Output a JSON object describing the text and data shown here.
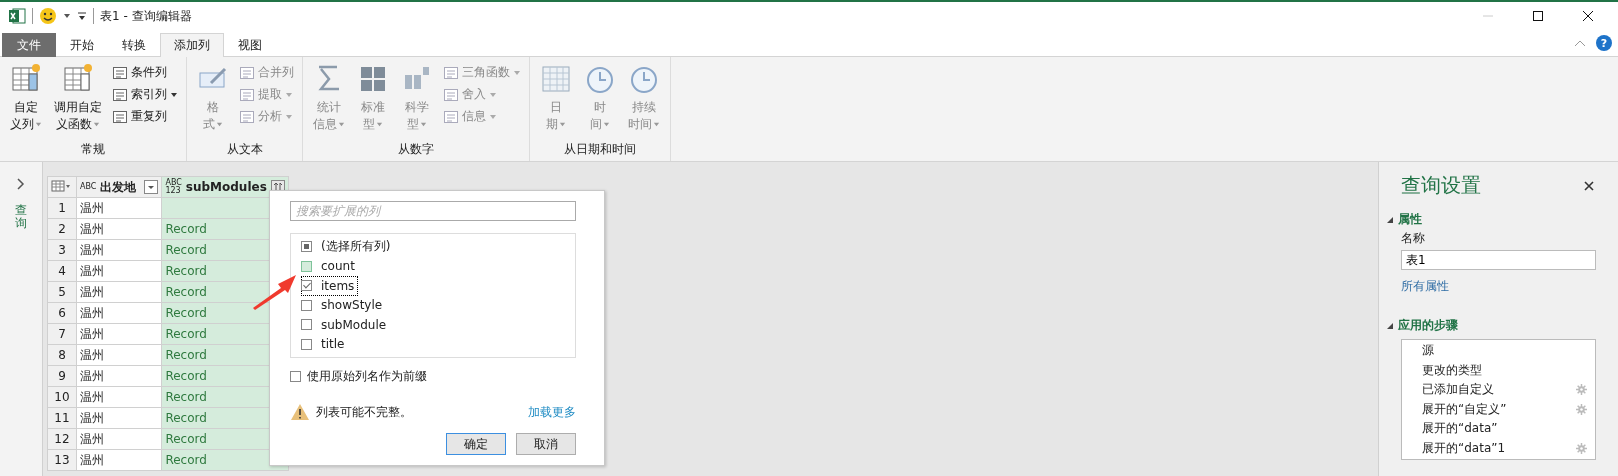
{
  "window": {
    "title": "表1 - 查询编辑器",
    "help": "?"
  },
  "tabs": [
    {
      "label": "文件",
      "kind": "file",
      "selected": false
    },
    {
      "label": "开始",
      "kind": "tab",
      "selected": false
    },
    {
      "label": "转换",
      "kind": "tab",
      "selected": false
    },
    {
      "label": "添加列",
      "kind": "tab",
      "selected": true
    },
    {
      "label": "视图",
      "kind": "tab",
      "selected": false
    }
  ],
  "ribbon_groups": [
    {
      "label": "常规",
      "large": [
        {
          "lines": [
            "自定",
            "义列"
          ],
          "disabled": false
        },
        {
          "lines": [
            "调用自定",
            "义函数"
          ],
          "disabled": false
        }
      ],
      "small": [
        {
          "label": "条件列",
          "disabled": false,
          "dropdown": false
        },
        {
          "label": "索引列",
          "disabled": false,
          "dropdown": true
        },
        {
          "label": "重复列",
          "disabled": false,
          "dropdown": false
        }
      ]
    },
    {
      "label": "从文本",
      "large": [
        {
          "lines": [
            "格",
            "式"
          ],
          "disabled": true
        }
      ],
      "small": [
        {
          "label": "合并列",
          "disabled": true,
          "dropdown": false
        },
        {
          "label": "提取",
          "disabled": true,
          "dropdown": true
        },
        {
          "label": "分析",
          "disabled": true,
          "dropdown": true
        }
      ]
    },
    {
      "label": "从数字",
      "large": [
        {
          "lines": [
            "统计",
            "信息"
          ],
          "disabled": true
        },
        {
          "lines": [
            "标准",
            "型"
          ],
          "disabled": true
        },
        {
          "lines": [
            "科学",
            "型"
          ],
          "disabled": true
        }
      ],
      "small": [
        {
          "label": "三角函数",
          "disabled": true,
          "dropdown": true
        },
        {
          "label": "舍入",
          "disabled": true,
          "dropdown": true
        },
        {
          "label": "信息",
          "disabled": true,
          "dropdown": true
        }
      ]
    },
    {
      "label": "从日期和时间",
      "large": [
        {
          "lines": [
            "日",
            "期"
          ],
          "disabled": true
        },
        {
          "lines": [
            "时",
            "间"
          ],
          "disabled": true
        },
        {
          "lines": [
            "持续",
            "时间"
          ],
          "disabled": true
        }
      ]
    }
  ],
  "queries_pane": {
    "label": "查询"
  },
  "table": {
    "columns": [
      {
        "name": "出发地",
        "type_label": "ABC",
        "selected": false
      },
      {
        "name": "subModules",
        "type_label": "ABC\n123",
        "selected": true
      }
    ],
    "rows": [
      {
        "index": "1",
        "cells": [
          "温州"
        ]
      },
      {
        "index": "2",
        "cells": [
          "温州",
          "Record"
        ]
      },
      {
        "index": "3",
        "cells": [
          "温州",
          "Record"
        ]
      },
      {
        "index": "4",
        "cells": [
          "温州",
          "Record"
        ]
      },
      {
        "index": "5",
        "cells": [
          "温州",
          "Record"
        ]
      },
      {
        "index": "6",
        "cells": [
          "温州",
          "Record"
        ]
      },
      {
        "index": "7",
        "cells": [
          "温州",
          "Record"
        ]
      },
      {
        "index": "8",
        "cells": [
          "温州",
          "Record"
        ]
      },
      {
        "index": "9",
        "cells": [
          "温州",
          "Record"
        ]
      },
      {
        "index": "10",
        "cells": [
          "温州",
          "Record"
        ]
      },
      {
        "index": "11",
        "cells": [
          "温州",
          "Record"
        ]
      },
      {
        "index": "12",
        "cells": [
          "温州",
          "Record"
        ]
      },
      {
        "index": "13",
        "cells": [
          "温州",
          "Record"
        ]
      }
    ]
  },
  "expand_popup": {
    "search": {
      "placeholder": "搜索要扩展的列"
    },
    "select_all": {
      "label": "(选择所有列)",
      "mixed": true
    },
    "columns": [
      {
        "label": "count",
        "checked": false,
        "hovered": true,
        "focused": false
      },
      {
        "label": "items",
        "checked": true,
        "hovered": false,
        "focused": true
      },
      {
        "label": "showStyle",
        "checked": false,
        "hovered": false,
        "focused": false
      },
      {
        "label": "subModule",
        "checked": false,
        "hovered": false,
        "focused": false
      },
      {
        "label": "title",
        "checked": false,
        "hovered": false,
        "focused": false
      }
    ],
    "prefix_option": {
      "label": "使用原始列名作为前缀",
      "checked": false
    },
    "warning": "列表可能不完整。",
    "load_more": "加载更多",
    "buttons": [
      {
        "label": "确定",
        "default": true
      },
      {
        "label": "取消",
        "default": false
      }
    ]
  },
  "query_settings": {
    "title": "查询设置",
    "properties_heading": "属性",
    "name_label": "名称",
    "name_value": "表1",
    "all_properties": "所有属性",
    "steps_heading": "应用的步骤",
    "steps": [
      {
        "label": "源",
        "has_settings": false,
        "selected": false
      },
      {
        "label": "更改的类型",
        "has_settings": false,
        "selected": false
      },
      {
        "label": "已添加自定义",
        "has_settings": true,
        "selected": false
      },
      {
        "label": "展开的“自定义”",
        "has_settings": true,
        "selected": false
      },
      {
        "label": "展开的“data”",
        "has_settings": false,
        "selected": false
      },
      {
        "label": "展开的“data”1",
        "has_settings": true,
        "selected": false
      }
    ]
  }
}
